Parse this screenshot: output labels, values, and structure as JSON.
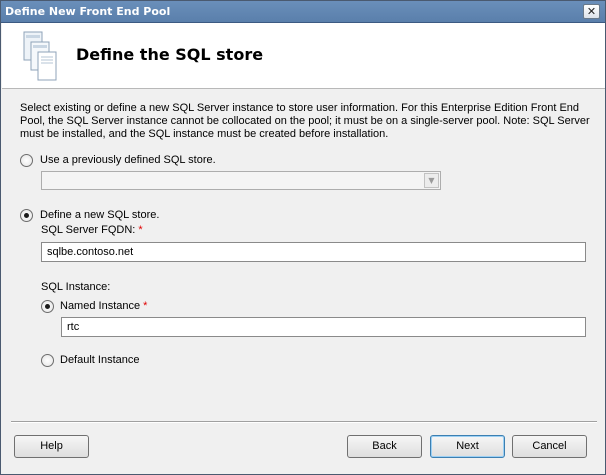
{
  "window": {
    "title": "Define New Front End Pool",
    "close_label": "✕"
  },
  "header": {
    "title": "Define the SQL store",
    "icon": "server-stack-icon"
  },
  "description": "Select existing or define a new SQL Server instance to store user information.  For this Enterprise Edition Front End Pool, the SQL Server instance cannot be collocated on the pool; it must be on a single-server pool.  Note: SQL Server must be installed, and the SQL instance must be created before installation.",
  "existing_store": {
    "label": "Use a previously defined SQL store.",
    "selected": false,
    "dropdown_value": ""
  },
  "new_store": {
    "label": "Define a new SQL store.",
    "selected": true,
    "fqdn_label": "SQL Server FQDN:",
    "fqdn_value": "sqlbe.contoso.net",
    "required_mark": "*",
    "instance_heading": "SQL Instance:",
    "named_instance_label": "Named Instance",
    "named_instance_selected": true,
    "named_instance_value": "rtc",
    "default_instance_label": "Default Instance",
    "default_instance_selected": false
  },
  "buttons": {
    "help": "Help",
    "back": "Back",
    "next": "Next",
    "cancel": "Cancel"
  }
}
